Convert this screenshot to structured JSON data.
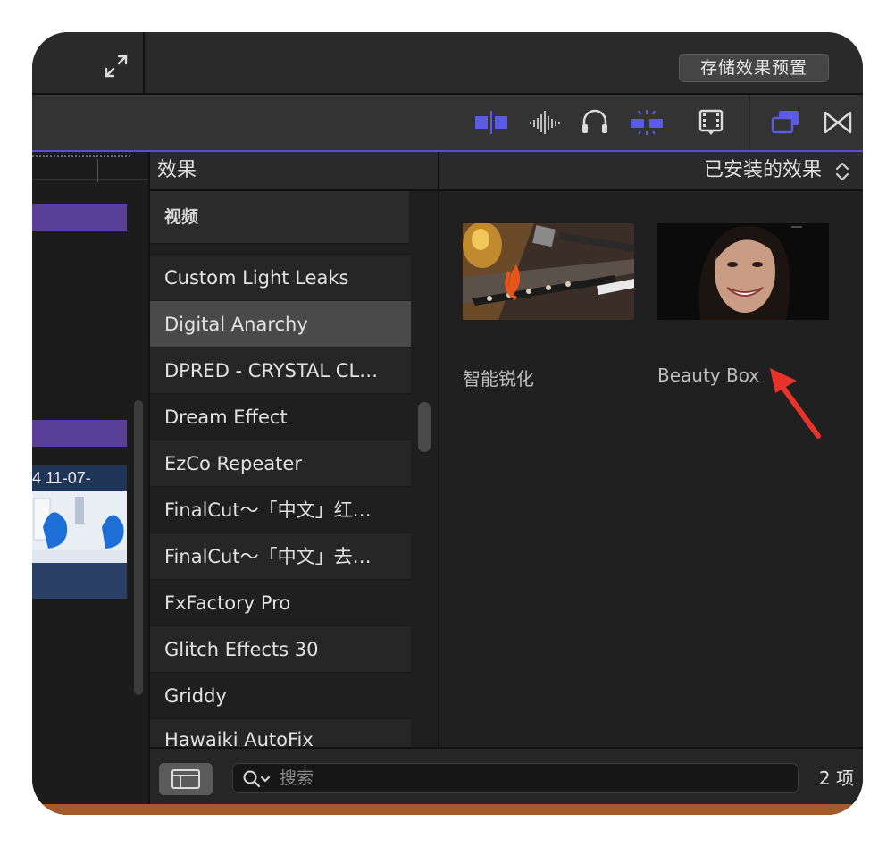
{
  "window": {
    "save_preset_label": "存储效果预置"
  },
  "toolbar": {
    "icons": [
      "clip-appearance-icon",
      "waveform-icon",
      "headphones-icon",
      "snapping-icon",
      "film-icon",
      "browser-overlay-icon",
      "transitions-icon"
    ]
  },
  "timeline": {
    "clip_title": "4 11-07-"
  },
  "effects_panel": {
    "title": "效果",
    "category_header": "视频",
    "items": [
      "Custom Light Leaks",
      "Digital Anarchy",
      "DPRED - CRYSTAL CL…",
      "Dream Effect",
      "EzCo Repeater",
      "FinalCut～「中文」红…",
      "FinalCut～「中文」去…",
      "FxFactory Pro",
      "Glitch Effects 30",
      "Griddy",
      "Hawaiki AutoFix"
    ],
    "selected_index": 1
  },
  "browser": {
    "filter_label": "已安装的效果",
    "effects": [
      {
        "name": "智能锐化"
      },
      {
        "name": "Beauty Box"
      }
    ]
  },
  "footer": {
    "search_placeholder": "搜索",
    "item_count": "2 项"
  },
  "colors": {
    "accent": "#5b5ce6",
    "timeline_clip": "#5a3f99",
    "annotation_arrow": "#e8322a"
  }
}
